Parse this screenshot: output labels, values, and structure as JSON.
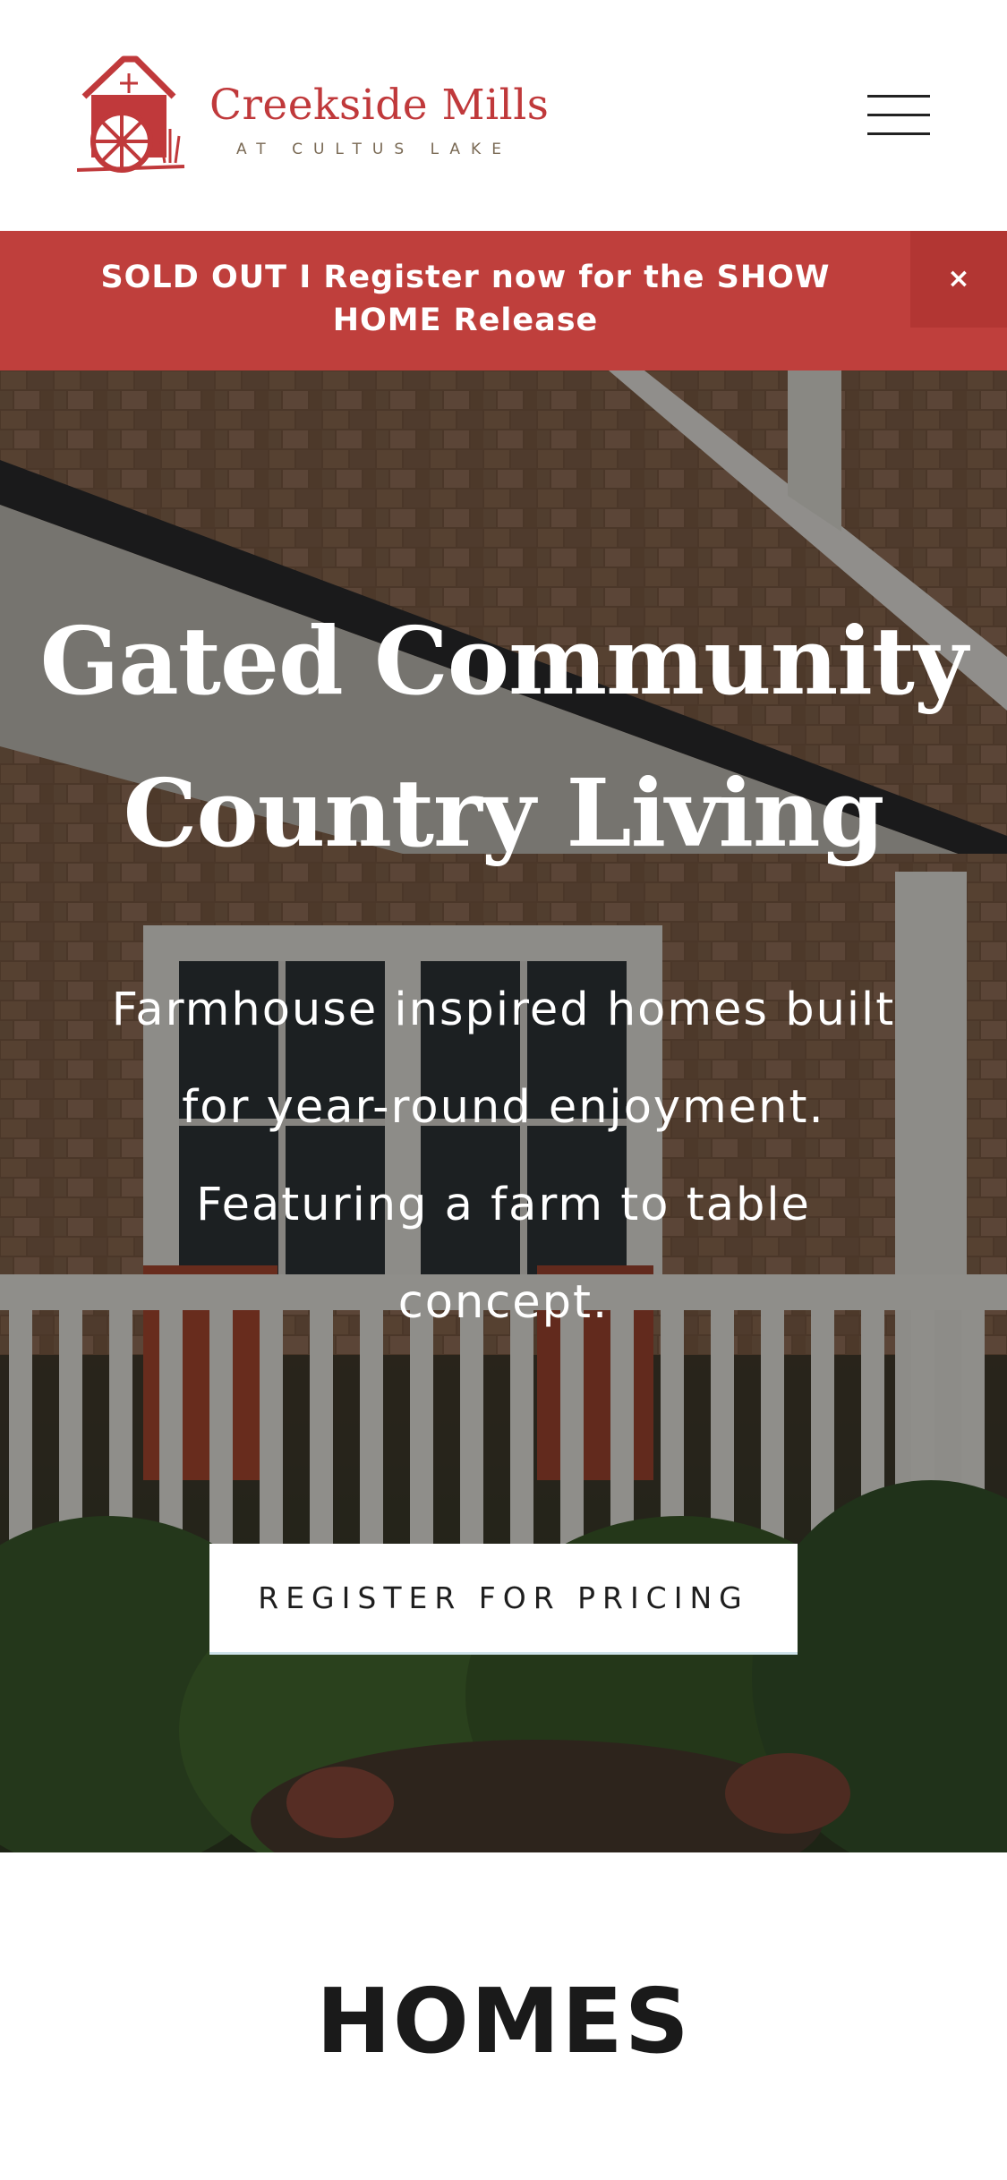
{
  "header": {
    "logo_name": "Creekside Mills",
    "logo_subtitle": "AT CULTUS LAKE",
    "menu_icon": "hamburger-menu-icon",
    "brand_color": "#c0393b"
  },
  "banner": {
    "text": "SOLD OUT   I   Register now for the SHOW HOME Release",
    "close_label": "×",
    "background": "#bf3f3c"
  },
  "hero": {
    "title": "Gated Community Country Living",
    "subtitle": "Farmhouse inspired homes built for year-round enjoyment. Featuring a farm to table concept.",
    "cta_label": "REGISTER FOR PRICING"
  },
  "homes": {
    "title": "HOMES"
  }
}
